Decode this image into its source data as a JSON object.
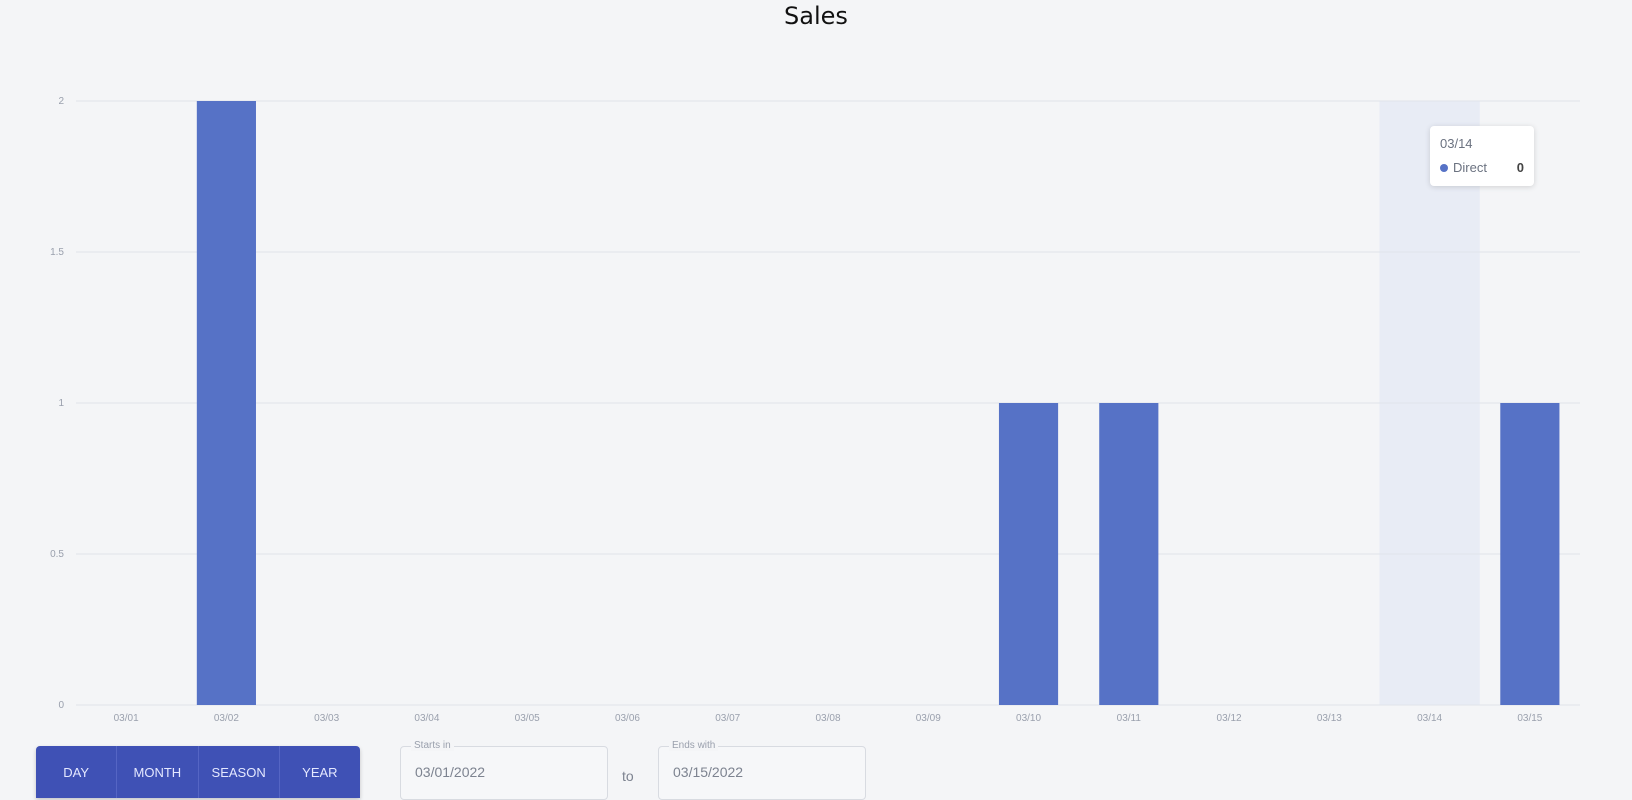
{
  "chart_data": {
    "type": "bar",
    "title": "Sales",
    "categories": [
      "03/01",
      "03/02",
      "03/03",
      "03/04",
      "03/05",
      "03/06",
      "03/07",
      "03/08",
      "03/09",
      "03/10",
      "03/11",
      "03/12",
      "03/13",
      "03/14",
      "03/15"
    ],
    "series": [
      {
        "name": "Direct",
        "values": [
          0,
          2,
          0,
          0,
          0,
          0,
          0,
          0,
          0,
          1,
          1,
          0,
          0,
          0,
          1
        ],
        "color": "#5672c6"
      }
    ],
    "yticks": [
      "0",
      "0.5",
      "1",
      "1.5",
      "2"
    ],
    "ylim": [
      0,
      2
    ],
    "grid": true,
    "highlighted_category": "03/14"
  },
  "tooltip": {
    "date": "03/14",
    "series_name": "Direct",
    "value": "0"
  },
  "range_buttons": [
    "DAY",
    "MONTH",
    "SEASON",
    "YEAR"
  ],
  "date_from": {
    "label": "Starts in",
    "value": "03/01/2022"
  },
  "date_to": {
    "label": "Ends with",
    "value": "03/15/2022"
  },
  "to_text": "to"
}
